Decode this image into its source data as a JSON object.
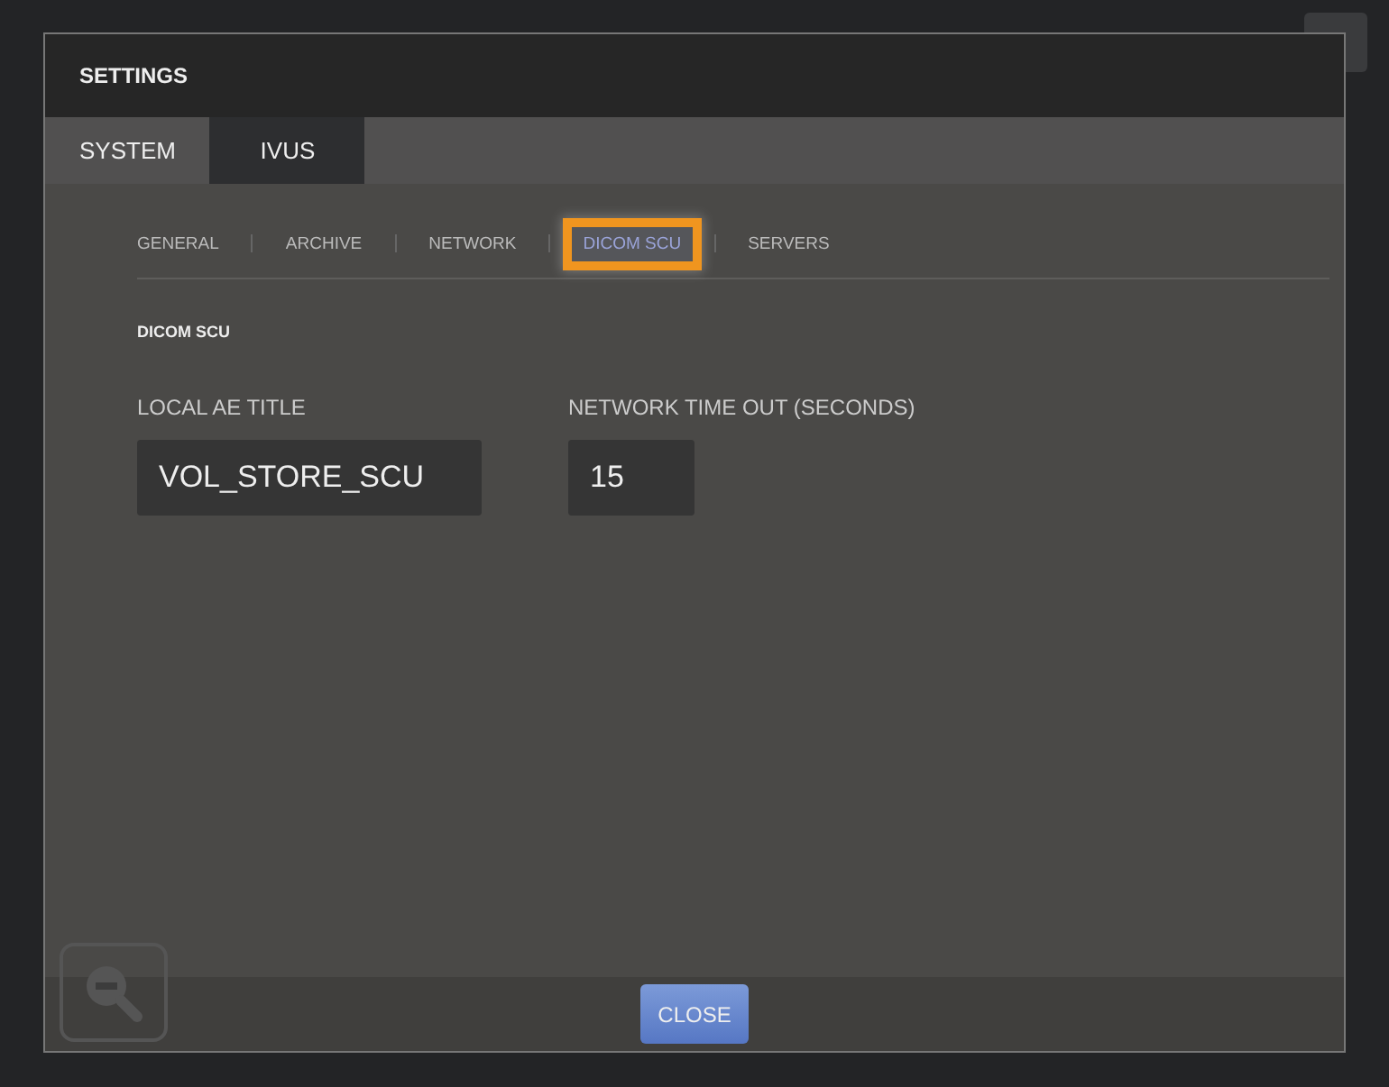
{
  "window": {
    "title": "SETTINGS"
  },
  "tabs": [
    {
      "label": "SYSTEM",
      "selected": false
    },
    {
      "label": "IVUS",
      "selected": true
    }
  ],
  "subtabs": [
    {
      "label": "GENERAL",
      "selected": false
    },
    {
      "label": "ARCHIVE",
      "selected": false
    },
    {
      "label": "NETWORK",
      "selected": false
    },
    {
      "label": "DICOM SCU",
      "selected": true
    },
    {
      "label": "SERVERS",
      "selected": false
    }
  ],
  "section": {
    "title": "DICOM SCU"
  },
  "fields": [
    {
      "label": "LOCAL AE TITLE",
      "value": "VOL_STORE_SCU"
    },
    {
      "label": "NETWORK TIME OUT (SECONDS)",
      "value": "15"
    }
  ],
  "buttons": [
    "CLOSE"
  ]
}
